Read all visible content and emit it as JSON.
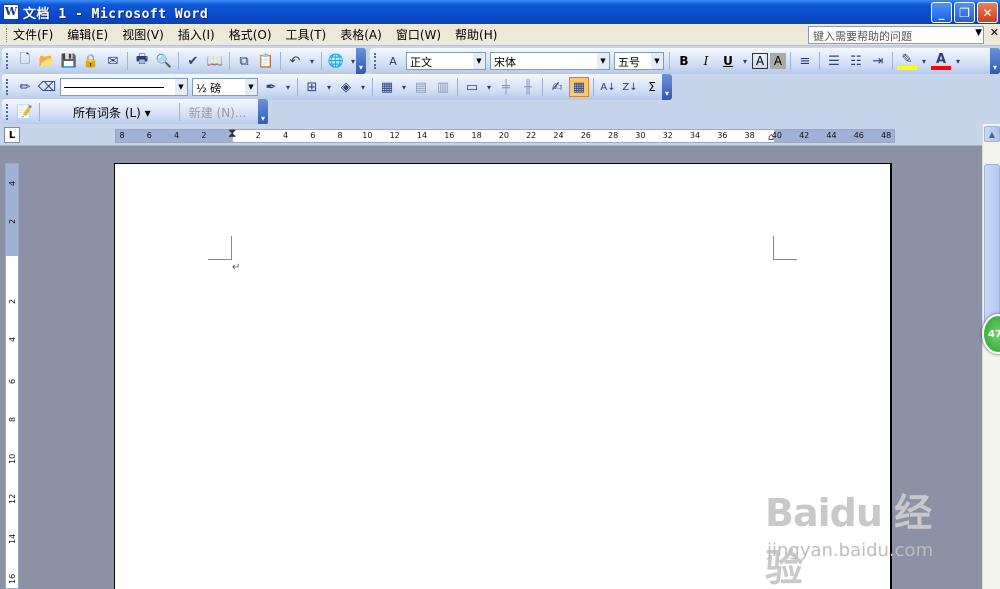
{
  "window": {
    "title": "文档 1 - Microsoft Word",
    "app_icon": "W",
    "buttons": {
      "minimize": "_",
      "restore": "❐",
      "close": "✕"
    }
  },
  "menubar": {
    "items": [
      "文件(F)",
      "编辑(E)",
      "视图(V)",
      "插入(I)",
      "格式(O)",
      "工具(T)",
      "表格(A)",
      "窗口(W)",
      "帮助(H)"
    ],
    "help_placeholder": "键入需要帮助的问题"
  },
  "standard_toolbar": {
    "icons": [
      "new-icon",
      "open-icon",
      "save-icon",
      "permission-icon",
      "email-icon",
      "print-icon",
      "print-preview-icon",
      "spelling-icon",
      "research-icon",
      "cut-icon",
      "copy-icon",
      "paste-icon",
      "undo-icon",
      "hyperlink-icon"
    ]
  },
  "formatting_toolbar": {
    "style": "正文",
    "font": "宋体",
    "size": "五号",
    "buttons": {
      "bold": "B",
      "italic": "I",
      "underline": "U",
      "char_border": "A",
      "char_shading": "A",
      "sigma": "Σ"
    },
    "highlight_color": "#ffff00",
    "font_color": "#ff0000"
  },
  "tables_toolbar": {
    "line_width": "½ 磅"
  },
  "autotext_toolbar": {
    "autotext_label": "所有词条 (L) ▾",
    "new_label": "新建 (N)..."
  },
  "ruler": {
    "horizontal_ticks": [
      "8",
      "6",
      "4",
      "2",
      "2",
      "4",
      "6",
      "8",
      "10",
      "12",
      "14",
      "16",
      "18",
      "20",
      "22",
      "24",
      "26",
      "28",
      "30",
      "32",
      "34",
      "36",
      "38",
      "40",
      "42",
      "44",
      "46",
      "48"
    ],
    "vertical_ticks": [
      "4",
      "2",
      "2",
      "4",
      "6",
      "8",
      "10",
      "12",
      "14",
      "16"
    ],
    "tab_selector": "L"
  },
  "document": {
    "paragraph_mark": "↵"
  },
  "scroll_badge": "47",
  "watermark": {
    "logo": "Baidu 经验",
    "url": "jingyan.baidu.com"
  }
}
